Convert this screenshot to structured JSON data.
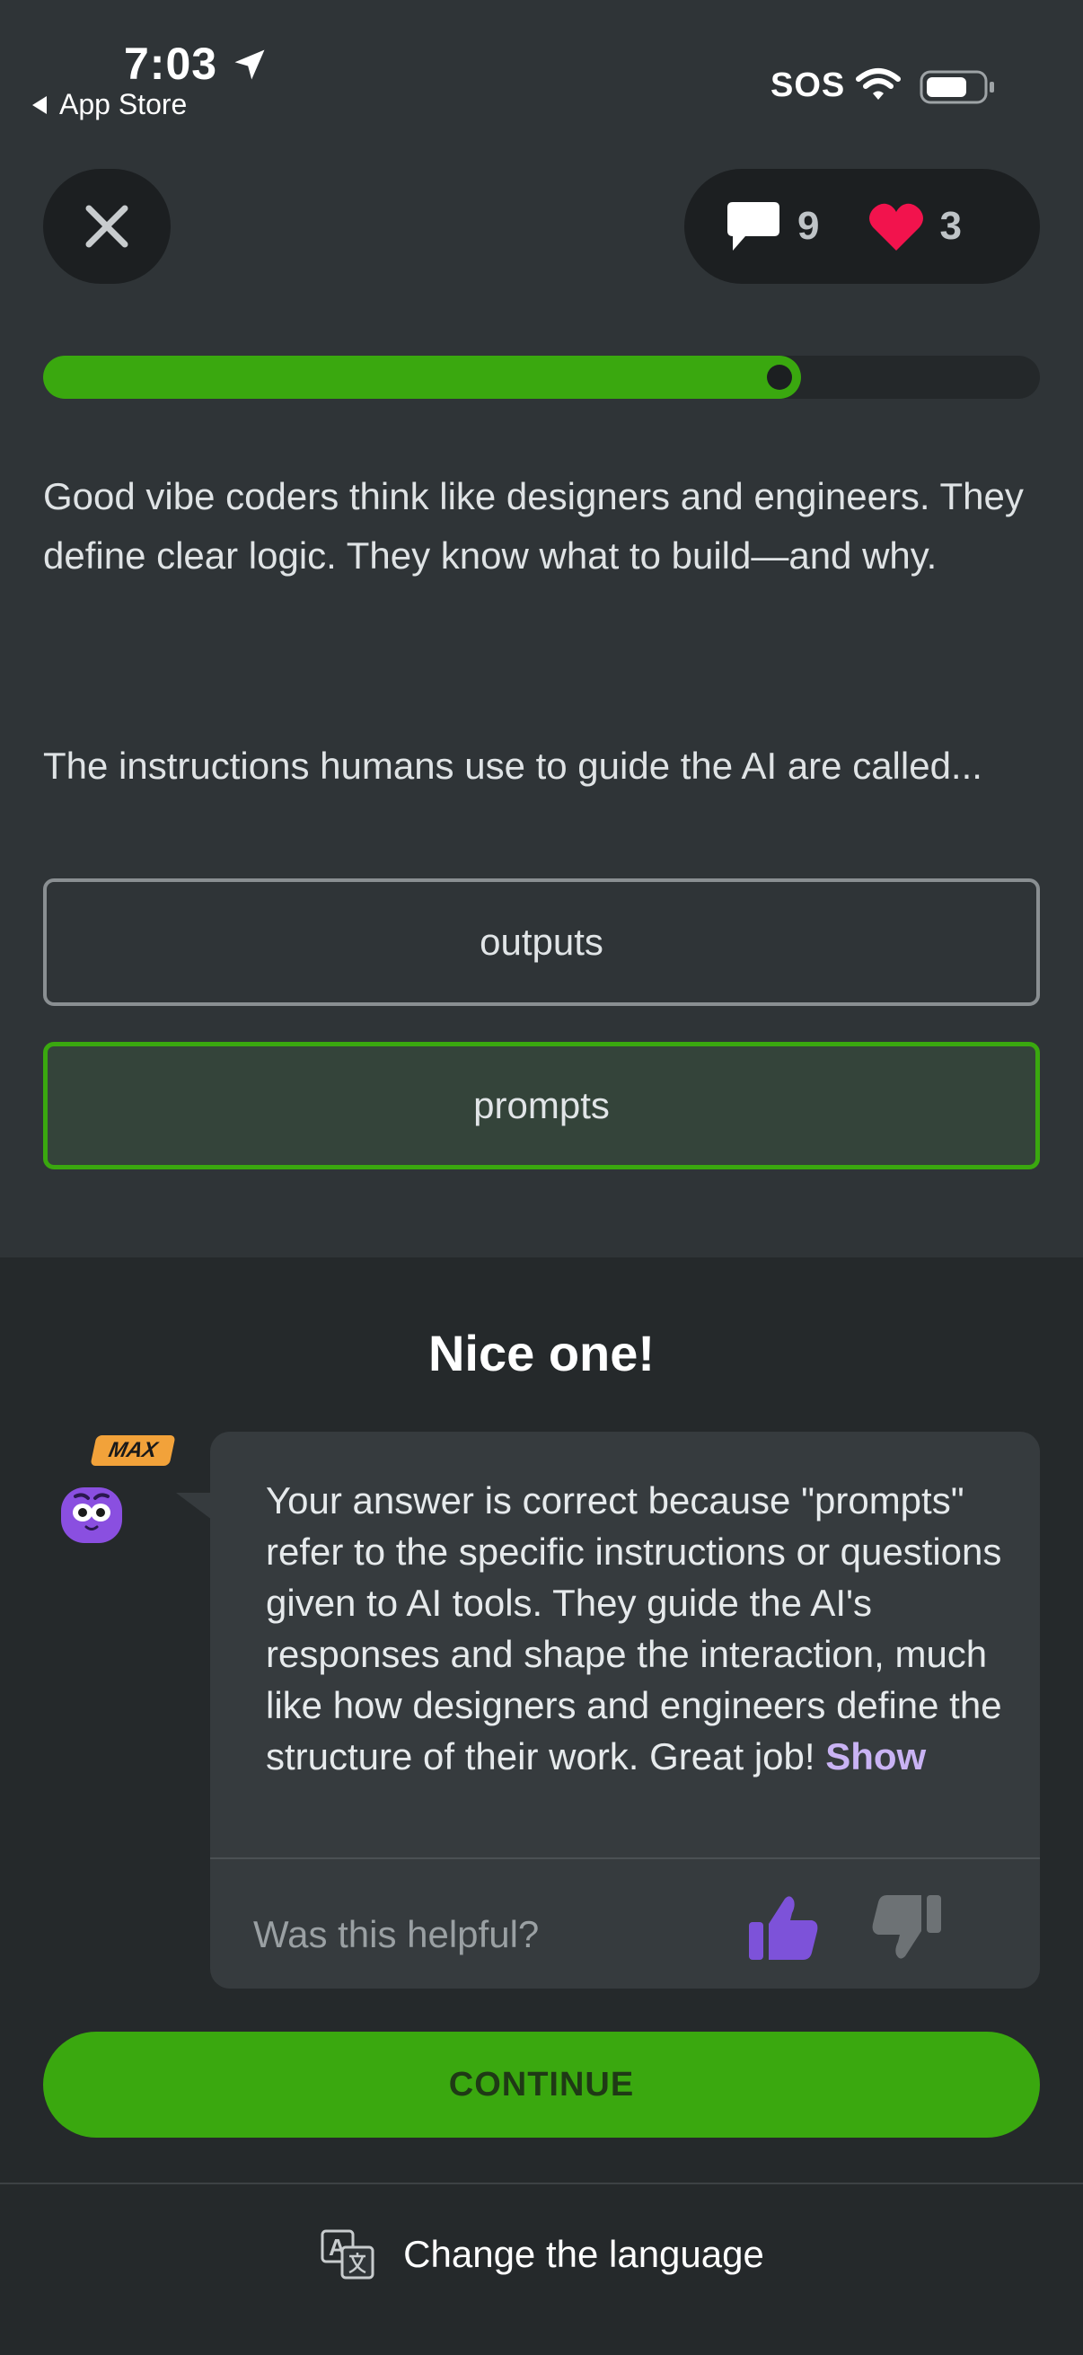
{
  "status_bar": {
    "time": "7:03",
    "back_app": "App Store",
    "carrier": "SOS"
  },
  "header": {
    "close_icon": "close-icon",
    "messages_count": "9",
    "hearts_count": "3",
    "heart_color": "#f2134d"
  },
  "progress": {
    "fraction": 0.76
  },
  "lesson": {
    "text": "Good vibe coders think like designers and engineers. They define clear logic. They know what to build—and why.",
    "question": "The instructions humans use to guide the AI are called..."
  },
  "options": [
    {
      "label": "outputs",
      "state": "default"
    },
    {
      "label": "prompts",
      "state": "correct"
    }
  ],
  "feedback": {
    "title": "Nice one!",
    "badge": "MAX",
    "explanation": "Your answer is correct because \"prompts\" refer to the specific instructions or questions given to AI tools. They guide the AI's responses and shape the interaction, much like how designers and engineers define the structure of their work. Great job! ",
    "show_more": "Show",
    "helpful_prompt": "Was this helpful?"
  },
  "actions": {
    "continue_label": "CONTINUE",
    "change_language": "Change the language"
  },
  "colors": {
    "accent_green": "#3aa80f",
    "accent_purple": "#7d52d9"
  }
}
